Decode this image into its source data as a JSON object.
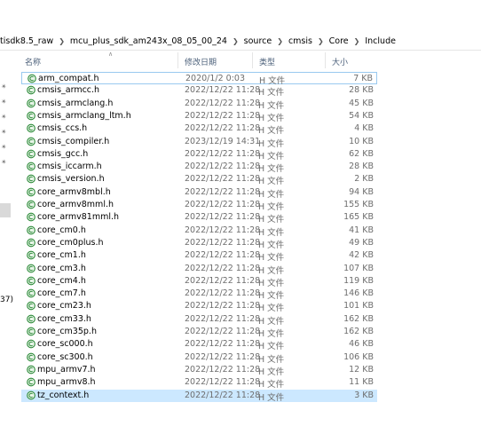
{
  "breadcrumb": [
    "tisdk8.5_raw",
    "mcu_plus_sdk_am243x_08_05_00_24",
    "source",
    "cmsis",
    "Core",
    "Include"
  ],
  "left_pane": {
    "partial_text": "37)"
  },
  "columns": {
    "name": "名称",
    "date": "修改日期",
    "type": "类型",
    "size": "大小"
  },
  "files": [
    {
      "name": "arm_compat.h",
      "date": "2020/1/2 0:03",
      "type": "H 文件",
      "size": "7 KB"
    },
    {
      "name": "cmsis_armcc.h",
      "date": "2022/12/22 11:28",
      "type": "H 文件",
      "size": "28 KB"
    },
    {
      "name": "cmsis_armclang.h",
      "date": "2022/12/22 11:28",
      "type": "H 文件",
      "size": "45 KB"
    },
    {
      "name": "cmsis_armclang_ltm.h",
      "date": "2022/12/22 11:28",
      "type": "H 文件",
      "size": "54 KB"
    },
    {
      "name": "cmsis_ccs.h",
      "date": "2022/12/22 11:28",
      "type": "H 文件",
      "size": "4 KB"
    },
    {
      "name": "cmsis_compiler.h",
      "date": "2023/12/19 14:31",
      "type": "H 文件",
      "size": "10 KB"
    },
    {
      "name": "cmsis_gcc.h",
      "date": "2022/12/22 11:28",
      "type": "H 文件",
      "size": "62 KB"
    },
    {
      "name": "cmsis_iccarm.h",
      "date": "2022/12/22 11:28",
      "type": "H 文件",
      "size": "28 KB"
    },
    {
      "name": "cmsis_version.h",
      "date": "2022/12/22 11:28",
      "type": "H 文件",
      "size": "2 KB"
    },
    {
      "name": "core_armv8mbl.h",
      "date": "2022/12/22 11:28",
      "type": "H 文件",
      "size": "94 KB"
    },
    {
      "name": "core_armv8mml.h",
      "date": "2022/12/22 11:28",
      "type": "H 文件",
      "size": "155 KB"
    },
    {
      "name": "core_armv81mml.h",
      "date": "2022/12/22 11:28",
      "type": "H 文件",
      "size": "165 KB"
    },
    {
      "name": "core_cm0.h",
      "date": "2022/12/22 11:28",
      "type": "H 文件",
      "size": "41 KB"
    },
    {
      "name": "core_cm0plus.h",
      "date": "2022/12/22 11:28",
      "type": "H 文件",
      "size": "49 KB"
    },
    {
      "name": "core_cm1.h",
      "date": "2022/12/22 11:28",
      "type": "H 文件",
      "size": "42 KB"
    },
    {
      "name": "core_cm3.h",
      "date": "2022/12/22 11:28",
      "type": "H 文件",
      "size": "107 KB"
    },
    {
      "name": "core_cm4.h",
      "date": "2022/12/22 11:28",
      "type": "H 文件",
      "size": "119 KB"
    },
    {
      "name": "core_cm7.h",
      "date": "2022/12/22 11:28",
      "type": "H 文件",
      "size": "146 KB"
    },
    {
      "name": "core_cm23.h",
      "date": "2022/12/22 11:28",
      "type": "H 文件",
      "size": "101 KB"
    },
    {
      "name": "core_cm33.h",
      "date": "2022/12/22 11:28",
      "type": "H 文件",
      "size": "162 KB"
    },
    {
      "name": "core_cm35p.h",
      "date": "2022/12/22 11:28",
      "type": "H 文件",
      "size": "162 KB"
    },
    {
      "name": "core_sc000.h",
      "date": "2022/12/22 11:28",
      "type": "H 文件",
      "size": "46 KB"
    },
    {
      "name": "core_sc300.h",
      "date": "2022/12/22 11:28",
      "type": "H 文件",
      "size": "106 KB"
    },
    {
      "name": "mpu_armv7.h",
      "date": "2022/12/22 11:28",
      "type": "H 文件",
      "size": "12 KB"
    },
    {
      "name": "mpu_armv8.h",
      "date": "2022/12/22 11:28",
      "type": "H 文件",
      "size": "11 KB"
    },
    {
      "name": "tz_context.h",
      "date": "2022/12/22 11:28",
      "type": "H 文件",
      "size": "3 KB"
    }
  ],
  "icons": {
    "file": "c-header-file-icon",
    "pin": "pin-icon",
    "sort": "sort-ascending-icon"
  },
  "colors": {
    "selection": "#cce8ff",
    "focus_border": "#99c9ef",
    "header_text": "#4c607a",
    "icon_green": "#2e8b3a"
  }
}
